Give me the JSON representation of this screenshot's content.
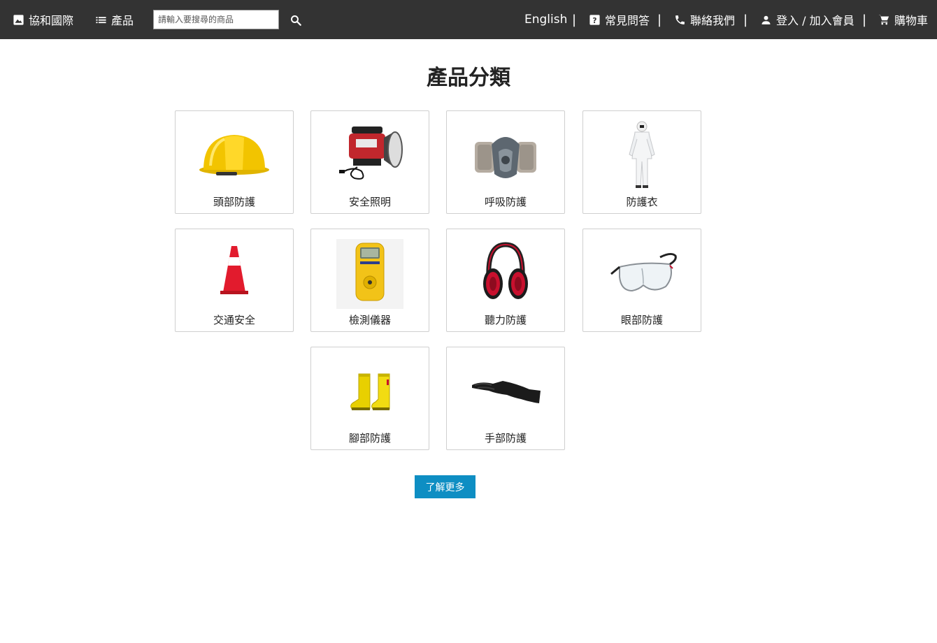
{
  "header": {
    "brand": "協和國際",
    "products": "產品",
    "search_placeholder": "請輸入要搜尋的商品",
    "language": "English",
    "faq": "常見問答",
    "contact": "聯絡我們",
    "login": "登入 / 加入會員",
    "cart": "購物車",
    "separator": "|"
  },
  "main": {
    "title": "產品分類",
    "categories": [
      {
        "label": "頭部防護",
        "icon": "hard-hat"
      },
      {
        "label": "安全照明",
        "icon": "spotlight"
      },
      {
        "label": "呼吸防護",
        "icon": "respirator"
      },
      {
        "label": "防護衣",
        "icon": "coverall"
      },
      {
        "label": "交通安全",
        "icon": "traffic-cone"
      },
      {
        "label": "檢測儀器",
        "icon": "gas-detector"
      },
      {
        "label": "聽力防護",
        "icon": "earmuffs"
      },
      {
        "label": "眼部防護",
        "icon": "safety-glasses"
      },
      {
        "label": "腳部防護",
        "icon": "rubber-boots"
      },
      {
        "label": "手部防護",
        "icon": "glove"
      }
    ],
    "more_button": "了解更多"
  },
  "colors": {
    "topbar": "#333333",
    "button": "#0e8ec3",
    "card_border": "#cfcfcf"
  }
}
